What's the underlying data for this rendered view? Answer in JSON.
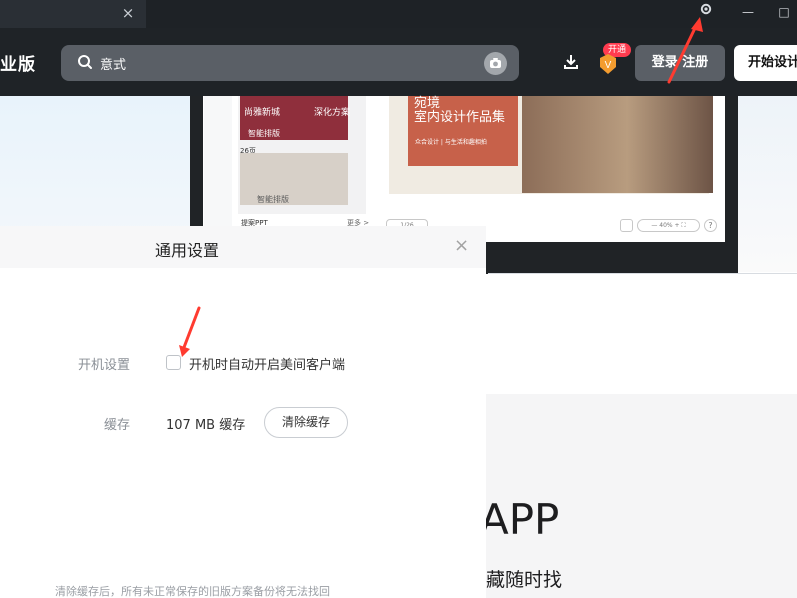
{
  "window": {
    "tab_close": "×",
    "minimize": "—",
    "maximize": "□"
  },
  "header": {
    "brand": "业版",
    "search_placeholder": "意式",
    "vip_badge": "开通",
    "login": "登录 注册",
    "start": "开始设计"
  },
  "preview": {
    "thumb1_left": "尚雅新城",
    "thumb1_right": "深化方案",
    "thumb1_badge": "智能排版",
    "thumb2_count": "26页",
    "thumb2_badge": "智能排版",
    "card_title": "宛境",
    "card_subtitle": "室内设计作品集",
    "card_small": "众合设计 | 与生活和趣相拍",
    "ppt_label": "提案PPT",
    "more_label": "更多 >",
    "page_label": "1/26",
    "zoom_label": "— 40% + ⛶",
    "help": "?"
  },
  "background": {
    "app_text": "APP",
    "subtext": "收藏随时找"
  },
  "dialog": {
    "title": "通用设置",
    "close": "×",
    "startup_label": "开机设置",
    "startup_option": "开机时自动开启美间客户端",
    "startup_checked": false,
    "cache_label": "缓存",
    "cache_value": "107 MB 缓存",
    "clear_cache": "清除缓存",
    "notice": "清除缓存后，所有未正常保存的旧版方案备份将无法找回"
  },
  "colors": {
    "header_bg": "#1f2327",
    "search_bg": "#5a5f66",
    "accent_red": "#ff3b30",
    "dialog_bg": "#ffffff",
    "text_muted": "#8a8f96"
  },
  "icons": [
    "search-icon",
    "camera-icon",
    "download-icon",
    "vip-icon",
    "gear-icon",
    "close-icon",
    "red-arrow-icon"
  ]
}
